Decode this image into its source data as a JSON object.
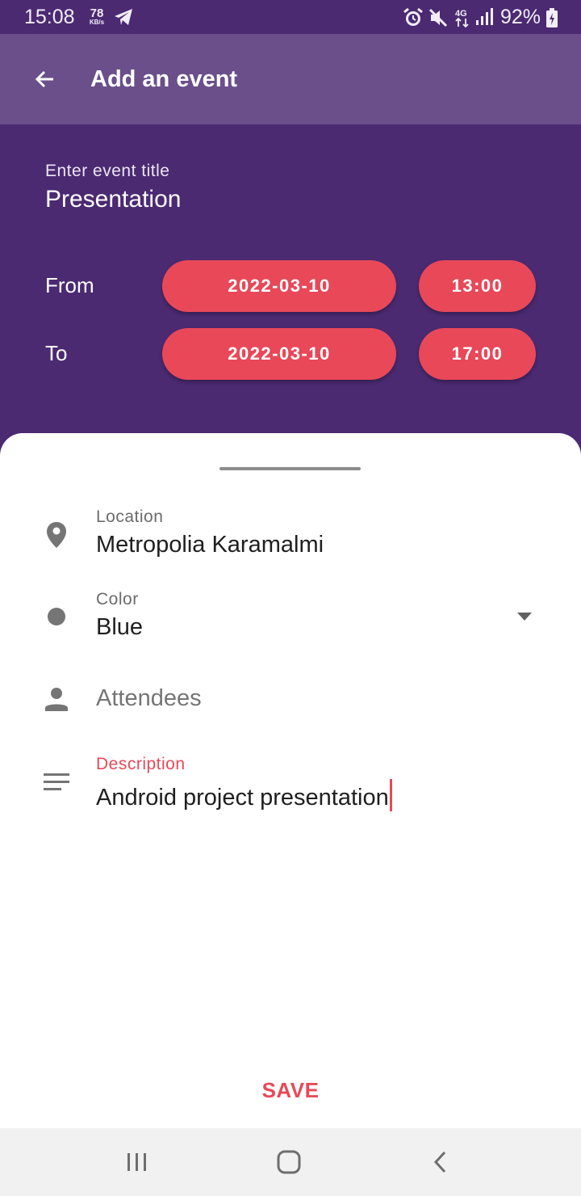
{
  "status_bar": {
    "time": "15:08",
    "speed_value": "78",
    "speed_unit": "KB/s",
    "battery_percent": "92%",
    "icons": [
      "telegram-icon",
      "alarm-icon",
      "mute-icon",
      "4g-icon",
      "signal-icon",
      "battery-icon"
    ]
  },
  "app_bar": {
    "title": "Add an event",
    "back_icon": "arrow-back-icon"
  },
  "event": {
    "title_label": "Enter event title",
    "title_value": "Presentation",
    "from_label": "From",
    "from_date": "2022-03-10",
    "from_time": "13:00",
    "to_label": "To",
    "to_date": "2022-03-10",
    "to_time": "17:00"
  },
  "details": {
    "location_label": "Location",
    "location_value": "Metropolia Karamalmi",
    "color_label": "Color",
    "color_value": "Blue",
    "attendees_hint": "Attendees",
    "description_label": "Description",
    "description_value": "Android project presentation"
  },
  "actions": {
    "save_label": "SAVE"
  },
  "nav_bar": {
    "icons": [
      "recent-apps-icon",
      "home-icon",
      "back-icon"
    ]
  },
  "colors": {
    "primary_dark": "#4b2a72",
    "app_bar": "#6a4f8a",
    "accent": "#e84858"
  }
}
